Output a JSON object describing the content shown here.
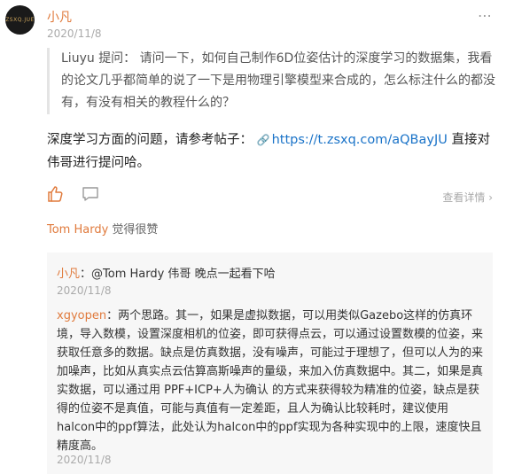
{
  "post": {
    "avatar_text": "ZSXQ.JUE",
    "author": "小凡",
    "date": "2020/11/8",
    "more_icon": "⋯",
    "quote_author": "Liuyu",
    "quote_prefix": "提问：",
    "quote_text": "请问一下，如何自己制作6D位姿估计的深度学习的数据集，我看的论文几乎都简单的说了一下是用物理引擎模型来合成的，怎么标注什么的都没有，有没有相关的教程什么的？",
    "body_before": "深度学习方面的问题，请参考帖子：",
    "link_icon": "🔗",
    "link_text": "https://t.zsxq.com/aQBayJU",
    "body_after": " 直接对伟哥进行提问哈。",
    "detail_label": "查看详情 ›"
  },
  "likes": {
    "liker": "Tom Hardy",
    "suffix": " 觉得很赞"
  },
  "comments": [
    {
      "name": "小凡",
      "text": "：@Tom Hardy 伟哥 晚点一起看下哈",
      "date": "2020/11/8"
    },
    {
      "name": "xgyopen",
      "text": "：两个思路。其一，如果是虚拟数据，可以用类似Gazebo这样的仿真环境，导入数模，设置深度相机的位姿，即可获得点云，可以通过设置数模的位姿，来获取任意多的数据。缺点是仿真数据，没有噪声，可能过于理想了，但可以人为的来加噪声，比如从真实点云估算高斯噪声的量级，来加入仿真数据中。其二，如果是真实数据，可以通过用 PPF+ICP+人为确认 的方式来获得较为精准的位姿，缺点是获得的位姿不是真值，可能与真值有一定差距，且人为确认比较耗时，建议使用halcon中的ppf算法，此处认为halcon中的ppf实现为各种实现中的上限，速度快且精度高。",
      "date": "2020/11/8"
    }
  ]
}
